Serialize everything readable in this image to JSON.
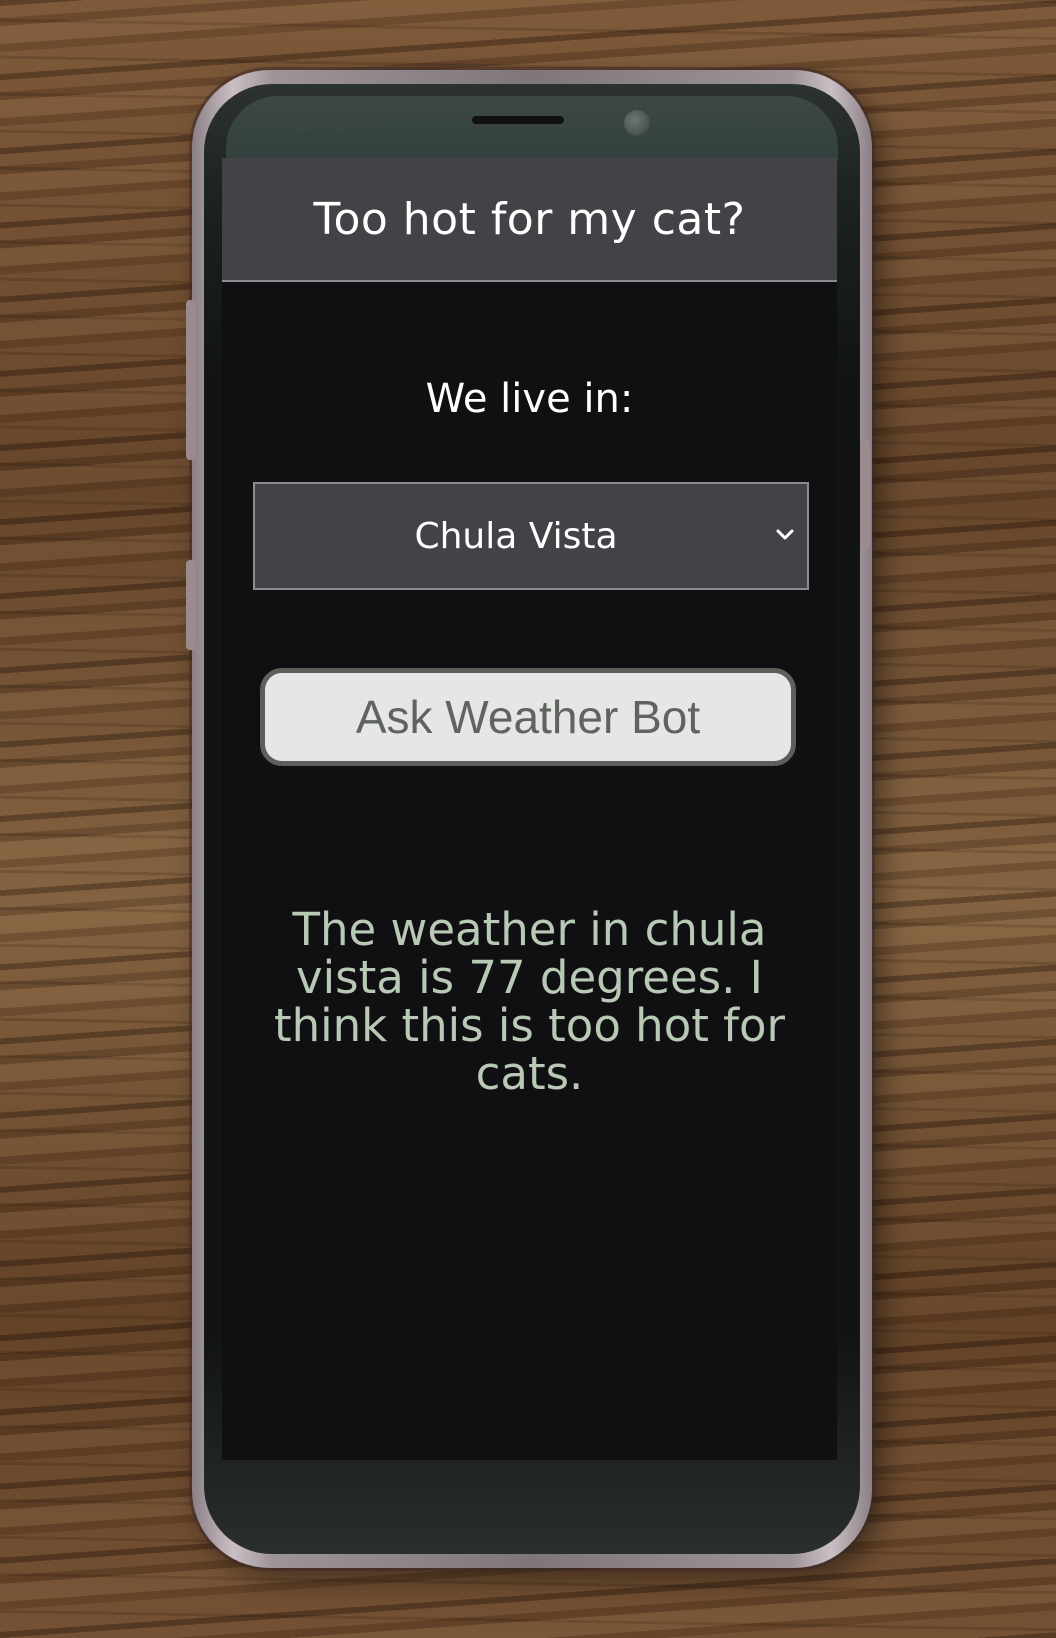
{
  "app": {
    "title": "Too hot for my cat?"
  },
  "form": {
    "location_label": "We live in:",
    "selected_city": "Chula Vista",
    "ask_button_label": "Ask Weather Bot"
  },
  "result": {
    "message": "The weather in chula vista is 77 degrees. I think this is too hot for cats."
  },
  "icons": {
    "dropdown": "chevron-down-icon"
  },
  "colors": {
    "header_bg": "#434247",
    "screen_bg": "#101012",
    "button_bg": "#e6e6e6",
    "button_text": "#5f655e",
    "result_text": "#b8c9b6"
  }
}
